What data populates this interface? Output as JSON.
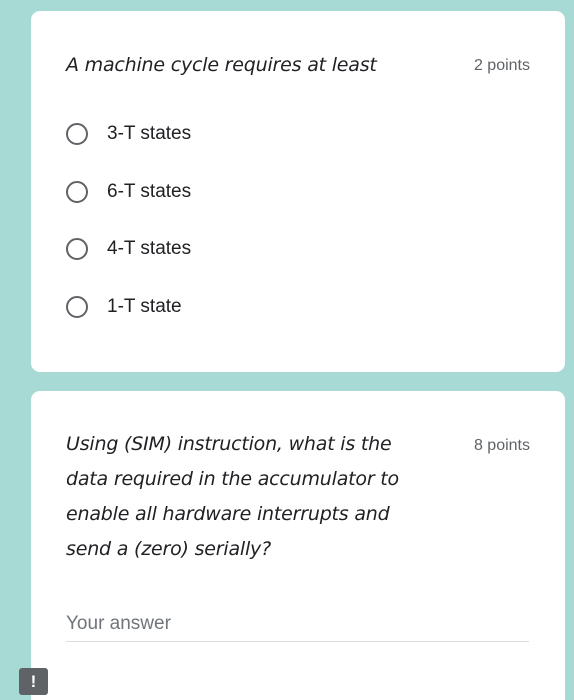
{
  "questions": [
    {
      "title": "A machine cycle requires at least",
      "points": "2 points",
      "options": [
        "3-T states",
        "6-T states",
        "4-T states",
        "1-T state"
      ]
    },
    {
      "title": "Using (SIM) instruction, what is the data required in the accumulator to enable all hardware interrupts and send a (zero) serially?",
      "points": "8 points",
      "answer_placeholder": "Your answer"
    }
  ],
  "feedback": {
    "symbol": "!"
  }
}
